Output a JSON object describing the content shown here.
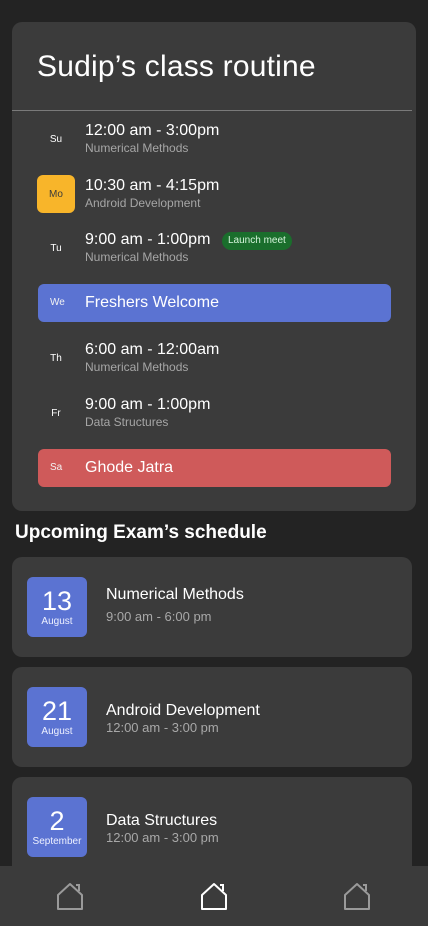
{
  "routine": {
    "title": "Sudip’s class routine",
    "days": [
      {
        "day": "Su",
        "time": "12:00 am - 3:00pm",
        "subject": "Numerical Methods"
      },
      {
        "day": "Mo",
        "time": "10:30 am - 4:15pm",
        "subject": "Android Development"
      },
      {
        "day": "Tu",
        "time": "9:00 am - 1:00pm",
        "subject": "Numerical Methods",
        "badge": "Launch meet"
      },
      {
        "day": "We",
        "event": "Freshers Welcome",
        "color": "#5b73d2"
      },
      {
        "day": "Th",
        "time": "6:00 am - 12:00am",
        "subject": "Numerical Methods"
      },
      {
        "day": "Fr",
        "time": "9:00 am - 1:00pm",
        "subject": "Data Structures"
      },
      {
        "day": "Sa",
        "event": "Ghode Jatra",
        "color": "#cf5a5a"
      }
    ],
    "active_day_color": "#f8b52a"
  },
  "upcoming": {
    "heading": "Upcoming Exam’s schedule",
    "exams": [
      {
        "day": "13",
        "month": "August",
        "subject": "Numerical Methods",
        "time": "9:00 am - 6:00 pm"
      },
      {
        "day": "21",
        "month": "August",
        "subject": "Android Development",
        "time": "12:00 am - 3:00 pm"
      },
      {
        "day": "2",
        "month": "September",
        "subject": "Data Structures",
        "time": "12:00 am - 3:00 pm"
      }
    ]
  },
  "nav": {
    "items": [
      {
        "icon": "home-icon"
      },
      {
        "icon": "home-icon"
      },
      {
        "icon": "home-icon"
      }
    ]
  }
}
